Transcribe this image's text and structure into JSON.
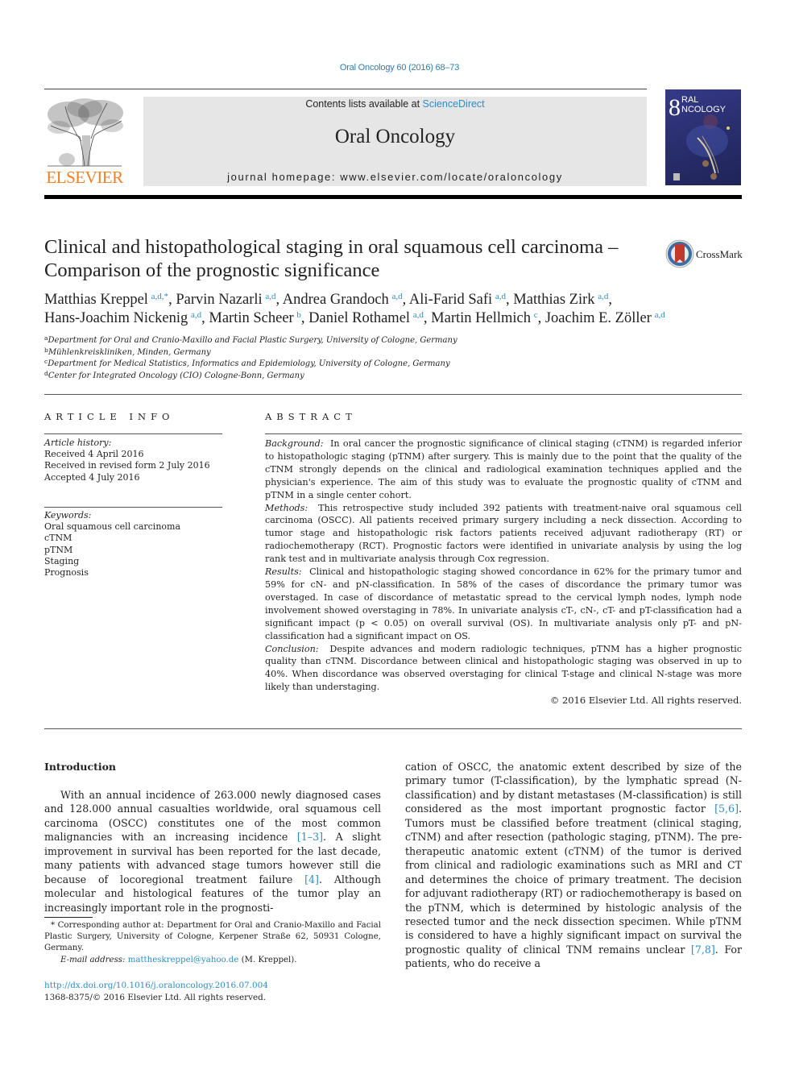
{
  "header": {
    "citation": "Oral Oncology 60 (2016) 68–73",
    "publisher_logo": "ELSEVIER",
    "contents_prefix": "Contents lists available at ",
    "contents_link": "ScienceDirect",
    "journal_title": "Oral Oncology",
    "homepage": "journal homepage: www.elsevier.com/locate/oraloncology",
    "cover_title_line1": "RAL",
    "cover_title_line2": "NCOLOGY",
    "crossmark_label": "CrossMark"
  },
  "article": {
    "title": "Clinical and histopathological staging in oral squamous cell carcinoma – Comparison of the prognostic significance",
    "authors": [
      {
        "name": "Matthias Kreppel",
        "sup": "a,d,*",
        "sep": ", "
      },
      {
        "name": "Parvin Nazarli",
        "sup": "a,d",
        "sep": ", "
      },
      {
        "name": "Andrea Grandoch",
        "sup": "a,d",
        "sep": ", "
      },
      {
        "name": "Ali-Farid Safi",
        "sup": "a,d",
        "sep": ", "
      },
      {
        "name": "Matthias Zirk",
        "sup": "a,d",
        "sep": ","
      },
      {
        "name": "Hans-Joachim Nickenig",
        "sup": "a,d",
        "sep": ", "
      },
      {
        "name": "Martin Scheer",
        "sup": "b",
        "sep": ", "
      },
      {
        "name": "Daniel Rothamel",
        "sup": "a,d",
        "sep": ", "
      },
      {
        "name": "Martin Hellmich",
        "sup": "c",
        "sep": ", "
      },
      {
        "name": "Joachim E. Zöller",
        "sup": "a,d",
        "sep": ""
      }
    ],
    "affiliations": [
      {
        "key": "a",
        "text": "Department for Oral and Cranio-Maxillo and Facial Plastic Surgery, University of Cologne, Germany"
      },
      {
        "key": "b",
        "text": "Mühlenkreiskliniken, Minden, Germany"
      },
      {
        "key": "c",
        "text": "Department for Medical Statistics, Informatics and Epidemiology, University of Cologne, Germany"
      },
      {
        "key": "d",
        "text": "Center for Integrated Oncology (CIO) Cologne-Bonn, Germany"
      }
    ]
  },
  "article_info": {
    "heading": "ARTICLE INFO",
    "history_label": "Article history:",
    "history": [
      "Received 4 April 2016",
      "Received in revised form 2 July 2016",
      "Accepted 4 July 2016"
    ],
    "keywords_label": "Keywords:",
    "keywords": [
      "Oral squamous cell carcinoma",
      "cTNM",
      "pTNM",
      "Staging",
      "Prognosis"
    ]
  },
  "abstract": {
    "heading": "ABSTRACT",
    "sections": [
      {
        "label": "Background:",
        "text": "In oral cancer the prognostic significance of clinical staging (cTNM) is regarded inferior to histopathologic staging (pTNM) after surgery. This is mainly due to the point that the quality of the cTNM strongly depends on the clinical and radiological examination techniques applied and the physician's experience. The aim of this study was to evaluate the prognostic quality of cTNM and pTNM in a single center cohort."
      },
      {
        "label": "Methods:",
        "text": "This retrospective study included 392 patients with treatment-naive oral squamous cell carcinoma (OSCC). All patients received primary surgery including a neck dissection. According to tumor stage and histopathologic risk factors patients received adjuvant radiotherapy (RT) or radiochemotherapy (RCT). Prognostic factors were identified in univariate analysis by using the log rank test and in multivariate analysis through Cox regression."
      },
      {
        "label": "Results:",
        "text": "Clinical and histopathologic staging showed concordance in 62% for the primary tumor and 59% for cN- and pN-classification. In 58% of the cases of discordance the primary tumor was overstaged. In case of discordance of metastatic spread to the cervical lymph nodes, lymph node involvement showed overstaging in 78%. In univariate analysis cT-, cN-, cT- and pT-classification had a significant impact (p < 0.05) on overall survival (OS). In multivariate analysis only pT- and pN-classification had a significant impact on OS."
      },
      {
        "label": "Conclusion:",
        "text": "Despite advances and modern radiologic techniques, pTNM has a higher prognostic quality than cTNM. Discordance between clinical and histopathologic staging was observed in up to 40%. When discordance was observed overstaging for clinical T-stage and clinical N-stage was more likely than understaging."
      }
    ],
    "copyright": "© 2016 Elsevier Ltd. All rights reserved."
  },
  "body": {
    "intro_heading": "Introduction",
    "left": {
      "p1_a": "With an annual incidence of 263.000 newly diagnosed cases and 128.000 annual casualties worldwide, oral squamous cell carcinoma (OSCC) constitutes one of the most common malignancies with an increasing incidence ",
      "ref1": "[1–3]",
      "p1_b": ". A slight improvement in survival has been reported for the last decade, many patients with advanced stage tumors however still die because of locoregional treatment failure ",
      "ref2": "[4]",
      "p1_c": ". Although molecular and histological features of the tumor play an increasingly important role in the prognosti-"
    },
    "right": {
      "p_a": "cation of OSCC, the anatomic extent described by size of the primary tumor (T-classification), by the lymphatic spread (N-classification) and by distant metastases (M-classification) is still considered as the most important prognostic factor ",
      "ref1": "[5,6]",
      "p_b": ". Tumors must be classified before treatment (clinical staging, cTNM) and after resection (pathologic staging, pTNM). The pre-therapeutic anatomic extent (cTNM) of the tumor is derived from clinical and radiologic examinations such as MRI and CT and determines the choice of primary treatment. The decision for adjuvant radiotherapy (RT) or radiochemotherapy is based on the pTNM, which is determined by histologic analysis of the resected tumor and the neck dissection specimen. While pTNM is considered to have a highly significant impact on survival the prognostic quality of clinical TNM remains unclear ",
      "ref2": "[7,8]",
      "p_c": ". For patients, who do receive a"
    }
  },
  "footnote": {
    "corresponding": "* Corresponding author at: Department for Oral and Cranio-Maxillo and Facial Plastic Surgery, University of Cologne, Kerpener Straße 62, 50931 Cologne, Germany.",
    "email_label": "E-mail address:",
    "email": "mattheskreppel@yahoo.de",
    "email_suffix": " (M. Kreppel).",
    "doi": "http://dx.doi.org/10.1016/j.oraloncology.2016.07.004",
    "issn": "1368-8375/© 2016 Elsevier Ltd. All rights reserved."
  }
}
